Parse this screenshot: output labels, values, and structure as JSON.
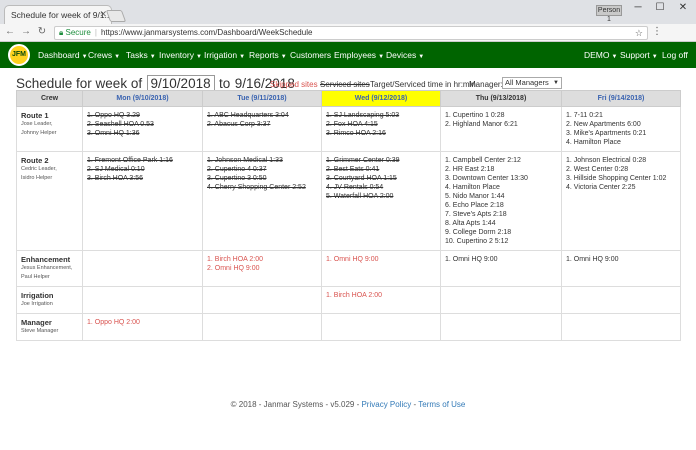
{
  "browser": {
    "tab_title": "Schedule for week of 9/1...",
    "user_chip": "Person 1",
    "secure_label": "Secure",
    "url": "https://www.janmarsystems.com/Dashboard/WeekSchedule"
  },
  "navbar": {
    "logo_text": "JFM",
    "items": [
      "Dashboard",
      "Crews",
      "Tasks",
      "Inventory",
      "Irrigation",
      "Reports",
      "Customers",
      "Employees",
      "Devices"
    ],
    "right": [
      "DEMO",
      "Support",
      "Log off"
    ]
  },
  "page": {
    "title_prefix": "Schedule for week of",
    "start_date": "9/10/2018",
    "to": "to",
    "end_date": "9/16/2018",
    "skipped_label": "Skipped sites",
    "serviced_label": "Serviced sites",
    "target_label": "Target/Serviced time in hr:min",
    "manager_label": "Manager:",
    "manager_value": "All Managers"
  },
  "table": {
    "headers": [
      "Crew",
      "Mon (9/10/2018)",
      "Tue (9/11/2018)",
      "Wed (9/12/2018)",
      "Thu (9/13/2018)",
      "Fri (9/14/2018)"
    ],
    "rows": [
      {
        "name": "Route 1",
        "sub": [
          "Jose Leader,",
          "Johnny Helper"
        ],
        "days": [
          [
            {
              "t": "1. Oppo HQ 3.29",
              "s": "done"
            },
            {
              "t": "2. Seashell HOA 0.53",
              "s": "done"
            },
            {
              "t": "3. Omni HQ 1:36",
              "s": "done"
            }
          ],
          [
            {
              "t": "1. ABC Headquarters 3:04",
              "s": "done"
            },
            {
              "t": "2. Abacus Corp 3:37",
              "s": "done"
            }
          ],
          [
            {
              "t": "1. SJ Landscaping 5:03",
              "s": "done"
            },
            {
              "t": "2. Fox HOA 4:15",
              "s": "done"
            },
            {
              "t": "3. Rimco HOA 2:16",
              "s": "done"
            }
          ],
          [
            {
              "t": "1. Cupertino 1 0:28",
              "s": ""
            },
            {
              "t": "2. Highland Manor 6:21",
              "s": ""
            }
          ],
          [
            {
              "t": "1. 7-11 0:21",
              "s": ""
            },
            {
              "t": "2. New Apartments 6:00",
              "s": ""
            },
            {
              "t": "3. Mike's Apartments 0:21",
              "s": ""
            },
            {
              "t": "4. Hamilton Place",
              "s": ""
            }
          ]
        ]
      },
      {
        "name": "Route 2",
        "sub": [
          "Cedric Leader,",
          "Isidro Helper"
        ],
        "days": [
          [
            {
              "t": "1. Fremont Office Park 1:16",
              "s": "done"
            },
            {
              "t": "2. SJ Medical 0:10",
              "s": "done"
            },
            {
              "t": "3. Birch HOA 3:56",
              "s": "done"
            }
          ],
          [
            {
              "t": "1. Johnson Medical 1:33",
              "s": "done"
            },
            {
              "t": "2. Cupertino 4 0:37",
              "s": "done"
            },
            {
              "t": "3. Cupertino 3 0:50",
              "s": "done"
            },
            {
              "t": "4. Cherry Shopping Center 2:52",
              "s": "done"
            }
          ],
          [
            {
              "t": "1. Grimmer Center 0:39",
              "s": "done"
            },
            {
              "t": "2. Best Eats 0:41",
              "s": "done"
            },
            {
              "t": "3. Courtyard HOA 1:15",
              "s": "done"
            },
            {
              "t": "4. JV Rentals 0:54",
              "s": "done"
            },
            {
              "t": "5. Waterfall HOA 2:00",
              "s": "done"
            }
          ],
          [
            {
              "t": "1. Campbell Center 2:12",
              "s": ""
            },
            {
              "t": "2. HR East 2:18",
              "s": ""
            },
            {
              "t": "3. Downtown Center 13:30",
              "s": ""
            },
            {
              "t": "4. Hamilton Place",
              "s": ""
            },
            {
              "t": "5. Nido Manor 1:44",
              "s": ""
            },
            {
              "t": "6. Echo Place 2:18",
              "s": ""
            },
            {
              "t": "7. Steve's Apts 2:18",
              "s": ""
            },
            {
              "t": "8. Alta Apts 1:44",
              "s": ""
            },
            {
              "t": "9. College Dorm 2:18",
              "s": ""
            },
            {
              "t": "10. Cupertino 2 5:12",
              "s": ""
            }
          ],
          [
            {
              "t": "1. Johnson Electrical 0:28",
              "s": ""
            },
            {
              "t": "2. West Center 0:28",
              "s": ""
            },
            {
              "t": "3. Hillside Shopping Center 1:02",
              "s": ""
            },
            {
              "t": "4. Victoria Center 2:25",
              "s": ""
            }
          ]
        ]
      },
      {
        "name": "Enhancement",
        "sub": [
          "Jesus Enhancement,",
          "Paul Helper"
        ],
        "days": [
          [],
          [
            {
              "t": "1. Birch HOA 2:00",
              "s": "skip"
            },
            {
              "t": "2. Omni HQ 9:00",
              "s": "skip"
            }
          ],
          [
            {
              "t": "1. Omni HQ 9:00",
              "s": "skip"
            }
          ],
          [
            {
              "t": "1. Omni HQ 9:00",
              "s": ""
            }
          ],
          [
            {
              "t": "1. Omni HQ 9:00",
              "s": ""
            }
          ]
        ]
      },
      {
        "name": "Irrigation",
        "sub": [
          "Joe Irrigation"
        ],
        "days": [
          [],
          [],
          [
            {
              "t": "1. Birch HOA 2:00",
              "s": "skip"
            }
          ],
          [],
          []
        ]
      },
      {
        "name": "Manager",
        "sub": [
          "Steve Manager"
        ],
        "days": [
          [
            {
              "t": "1. Oppo HQ 2:00",
              "s": "skip"
            }
          ],
          [],
          [],
          [],
          []
        ]
      }
    ]
  },
  "footer": {
    "copyright": "© 2018 - Janmar Systems - v5.029 -",
    "privacy": "Privacy Policy",
    "dash": "-",
    "terms": "Terms of Use"
  },
  "colors": {
    "navbar": "#006400",
    "today_header": "#ffff00",
    "skipped": "#d9534f"
  }
}
